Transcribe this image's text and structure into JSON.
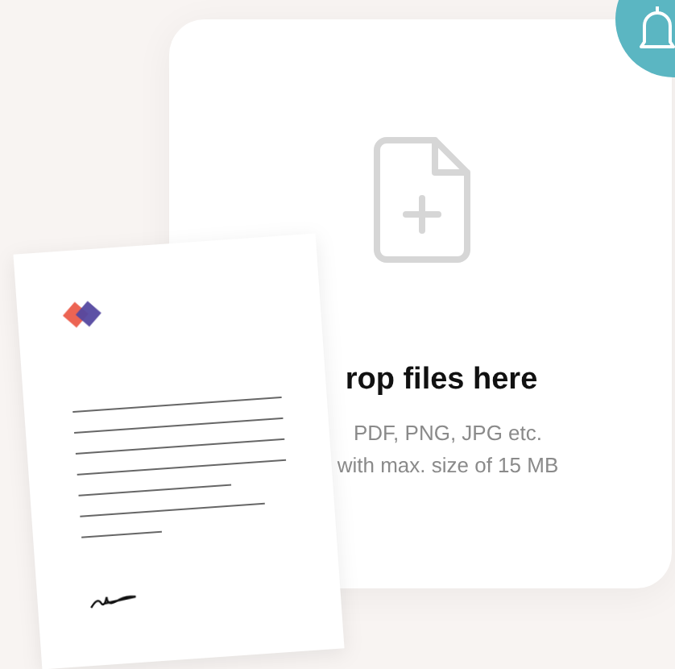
{
  "upload": {
    "title": "rop files here",
    "formats": "PDF, PNG, JPG etc.",
    "limit": "with max. size of 15 MB"
  }
}
